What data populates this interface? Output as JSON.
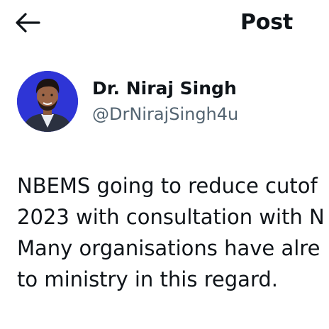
{
  "header": {
    "title": "Post",
    "back_icon": "arrow-left-icon"
  },
  "author": {
    "display_name": "Dr. Niraj Singh",
    "handle": "@DrNirajSingh4u",
    "avatar_background": "#2e35d6"
  },
  "post": {
    "lines": [
      "NBEMS going to reduce cutof",
      "2023 with consultation with N",
      "Many organisations have alre",
      "to ministry in this regard."
    ]
  }
}
